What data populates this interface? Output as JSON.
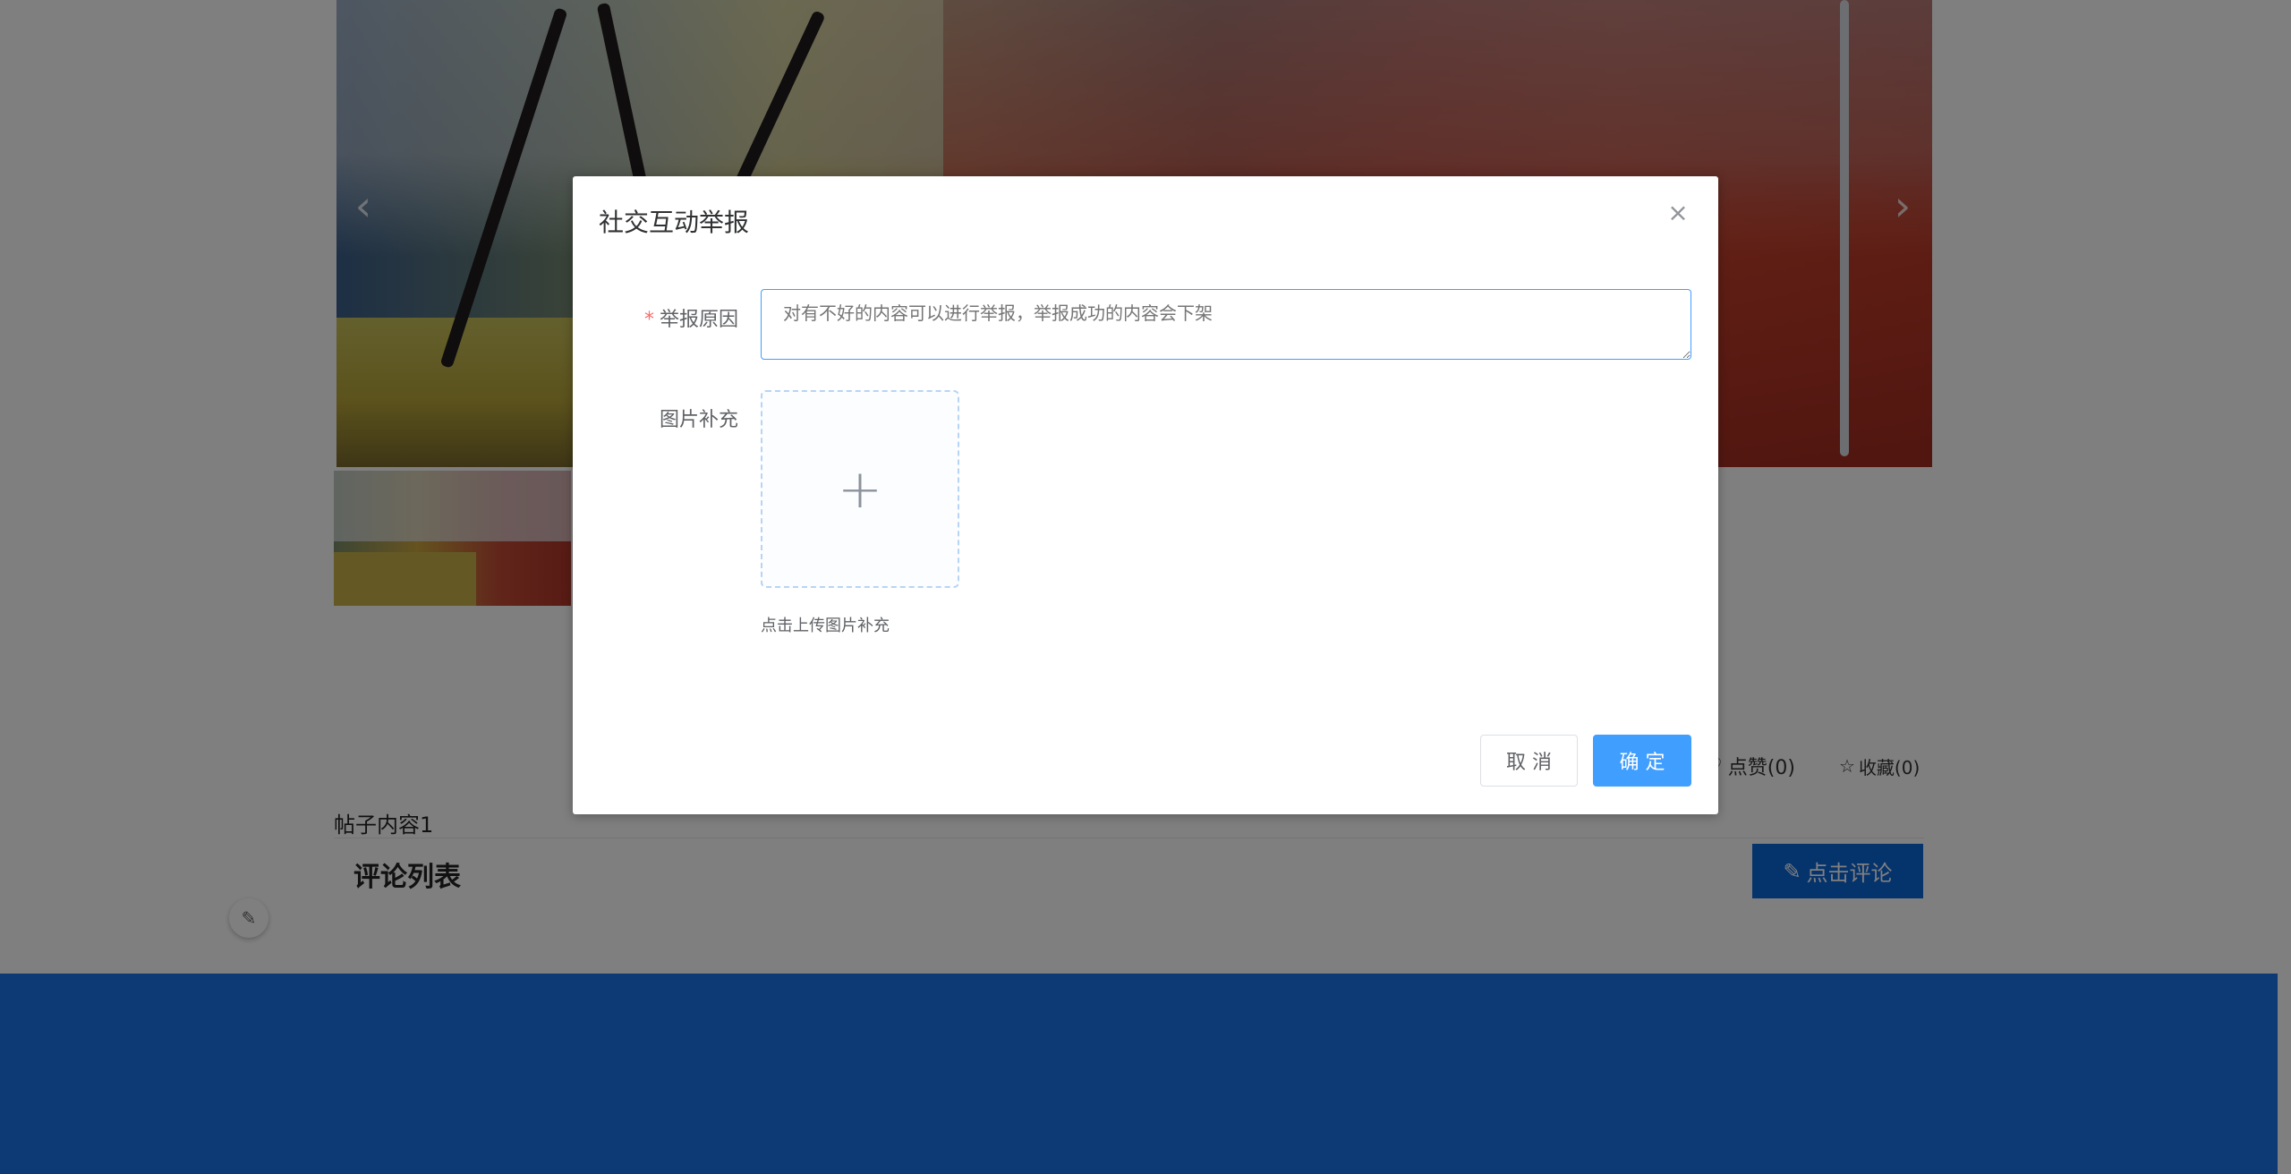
{
  "background": {
    "prev_arrow": "‹",
    "next_arrow": "›",
    "like_icon": "heart-icon",
    "like_label": "点赞(0)",
    "favorite_icon": "star-icon",
    "favorite_label": "收藏(0)",
    "post_content": "帖子内容1",
    "comment_list_title": "评论列表",
    "comment_button_icon": "edit-icon",
    "comment_button_label": "点击评论",
    "footer_color": "#1a73e8"
  },
  "dialog": {
    "title": "社交互动举报",
    "close_glyph": "×",
    "reason": {
      "required_mark": "*",
      "label": "举报原因",
      "value": "",
      "placeholder": "对有不好的内容可以进行举报，举报成功的内容会下架"
    },
    "image": {
      "label": "图片补充",
      "plus_glyph": "+",
      "tip": "点击上传图片补充"
    },
    "cancel_label": "取 消",
    "confirm_label": "确 定",
    "primary_color": "#409eff"
  }
}
